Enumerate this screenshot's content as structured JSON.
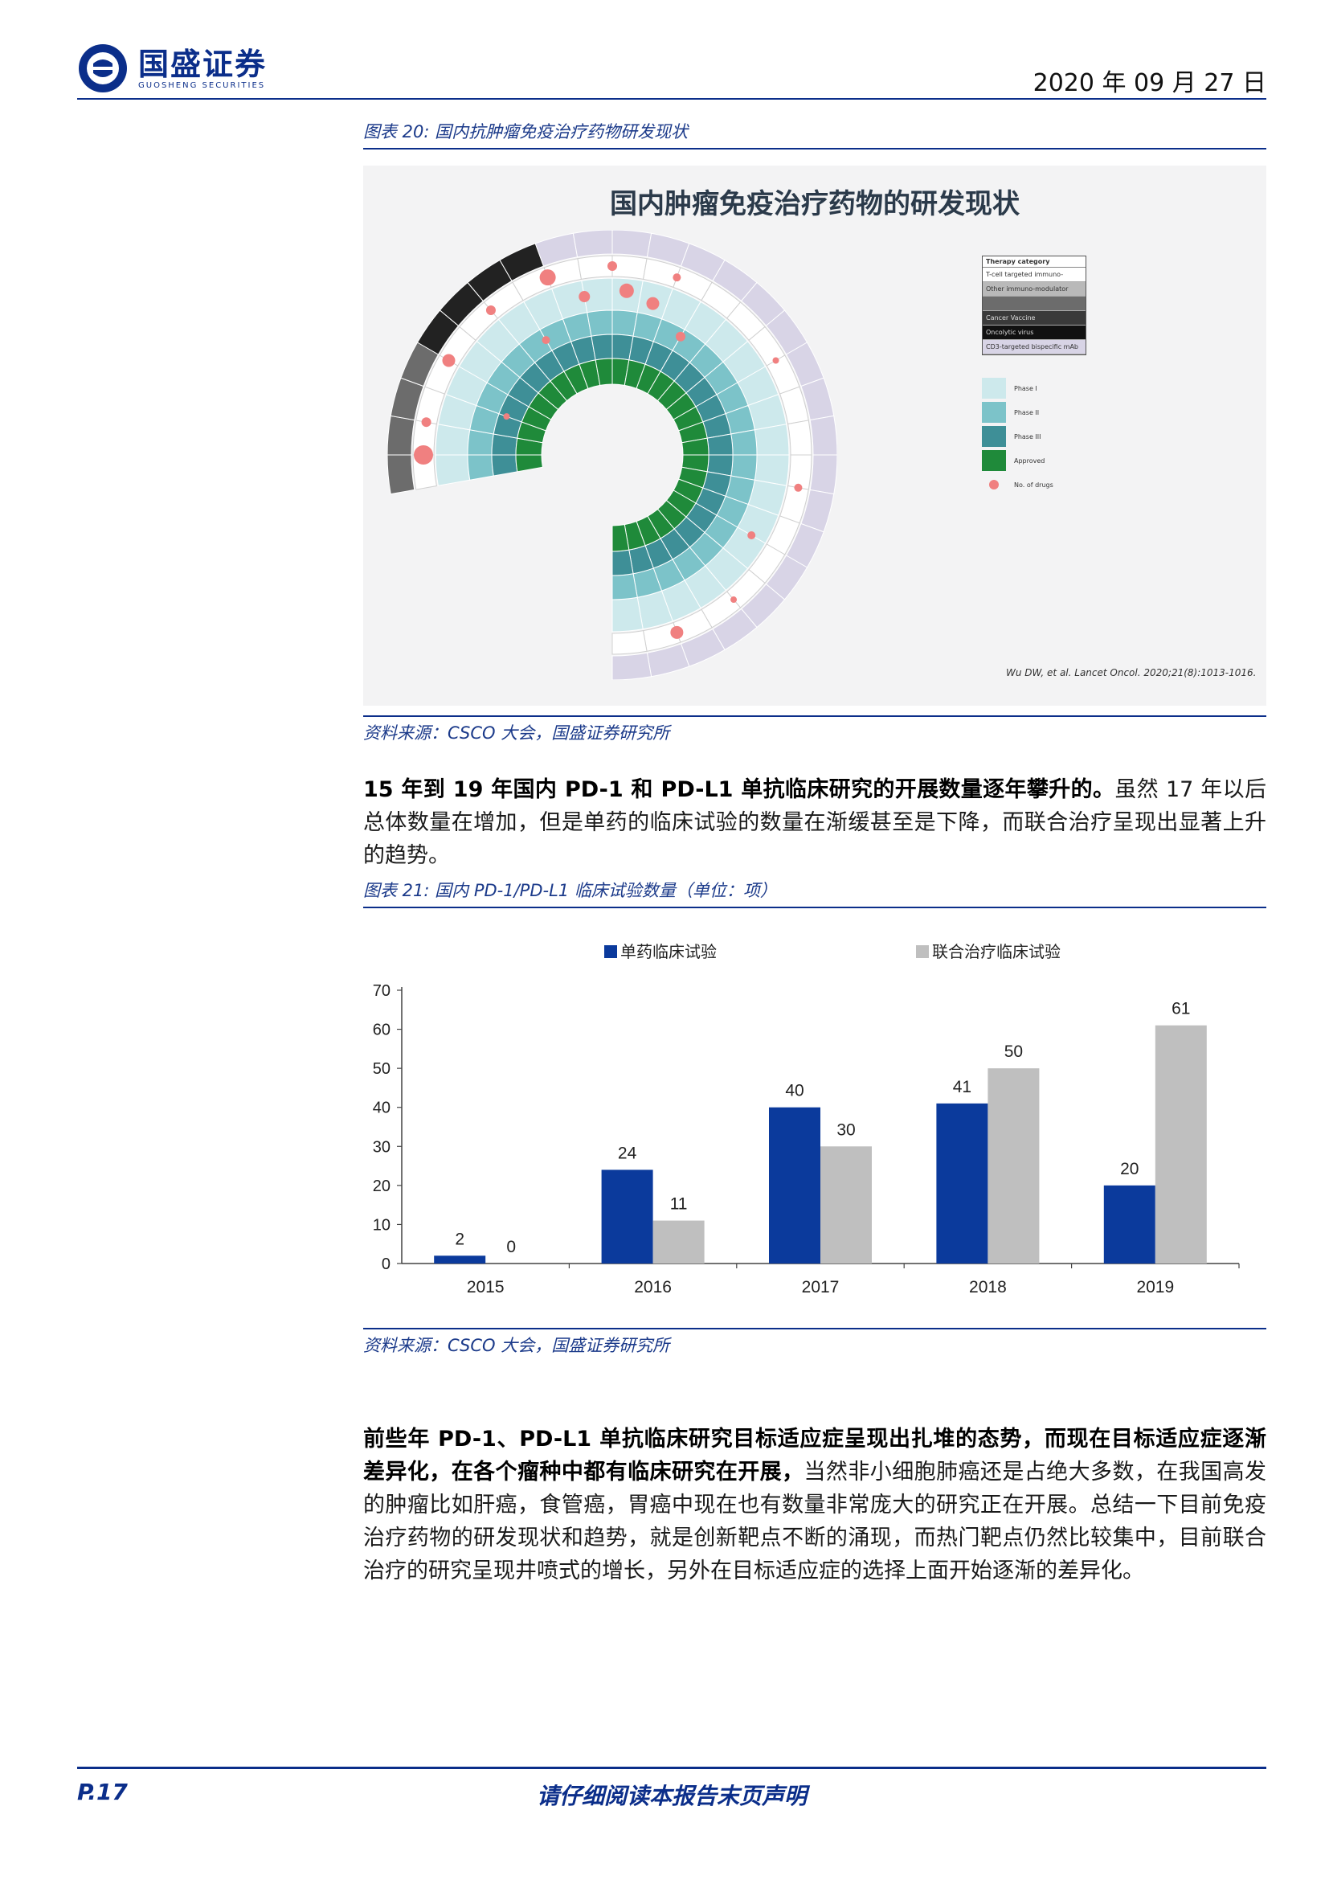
{
  "header": {
    "brand_cn": "国盛证券",
    "brand_en": "GUOSHENG SECURITIES",
    "date": "2020 年 09 月 27 日"
  },
  "figure20": {
    "caption": "图表 20:  国内抗肿瘤免疫治疗药物研发现状",
    "image_title": "国内肿瘤免疫治疗药物的研发现状",
    "legend_title": "Therapy category",
    "legend_items": [
      "T-cell targeted immuno-modulator",
      "Other immuno-modulator",
      "",
      "Cancer Vaccine",
      "Oncolytic virus",
      "CD3-targeted bispecific mAb"
    ],
    "phase_legend": [
      "Phase I",
      "Phase II",
      "Phase III",
      "Approved",
      "No. of drugs"
    ],
    "citation": "Wu DW, et al. Lancet Oncol. 2020;21(8):1013-1016.",
    "source": "资料来源：CSCO 大会，国盛证券研究所"
  },
  "paragraph1": {
    "bold": "15 年到 19 年国内 PD-1 和 PD-L1 单抗临床研究的开展数量逐年攀升的。",
    "normal": "虽然 17 年以后总体数量在增加，但是单药的临床试验的数量在渐缓甚至是下降，而联合治疗呈现出显著上升的趋势。"
  },
  "figure21": {
    "caption": "图表 21:  国内 PD-1/PD-L1 临床试验数量（单位：项）",
    "source": "资料来源：CSCO 大会，国盛证券研究所"
  },
  "chart_data": {
    "type": "bar",
    "categories": [
      "2015",
      "2016",
      "2017",
      "2018",
      "2019"
    ],
    "series": [
      {
        "name": "单药临床试验",
        "values": [
          2,
          24,
          40,
          41,
          20
        ],
        "color": "#0b3a9c"
      },
      {
        "name": "联合治疗临床试验",
        "values": [
          0,
          11,
          30,
          50,
          61
        ],
        "color": "#bfbfbf"
      }
    ],
    "yticks": [
      "0",
      "10",
      "20",
      "30",
      "40",
      "50",
      "60",
      "70"
    ],
    "ylim": [
      0,
      70
    ],
    "legend_position": "top",
    "grid": false
  },
  "paragraph2": {
    "bold1": "前些年 PD-1、PD-L1 单抗临床研究目标适应症呈现出扎堆的态势，而现在目标适应症逐渐差异化，在各个瘤种中都有临床研究在开展，",
    "normal": "当然非小细胞肺癌还是占绝大多数，在我国高发的肿瘤比如肝癌，食管癌，胃癌中现在也有数量非常庞大的研究正在开展。总结一下目前免疫治疗药物的研发现状和趋势，就是创新靶点不断的涌现，而热门靶点仍然比较集中，目前联合治疗的研究呈现井喷式的增长，另外在目标适应症的选择上面开始逐渐的差异化。"
  },
  "footer": {
    "page": "P.17",
    "note": "请仔细阅读本报告末页声明"
  }
}
